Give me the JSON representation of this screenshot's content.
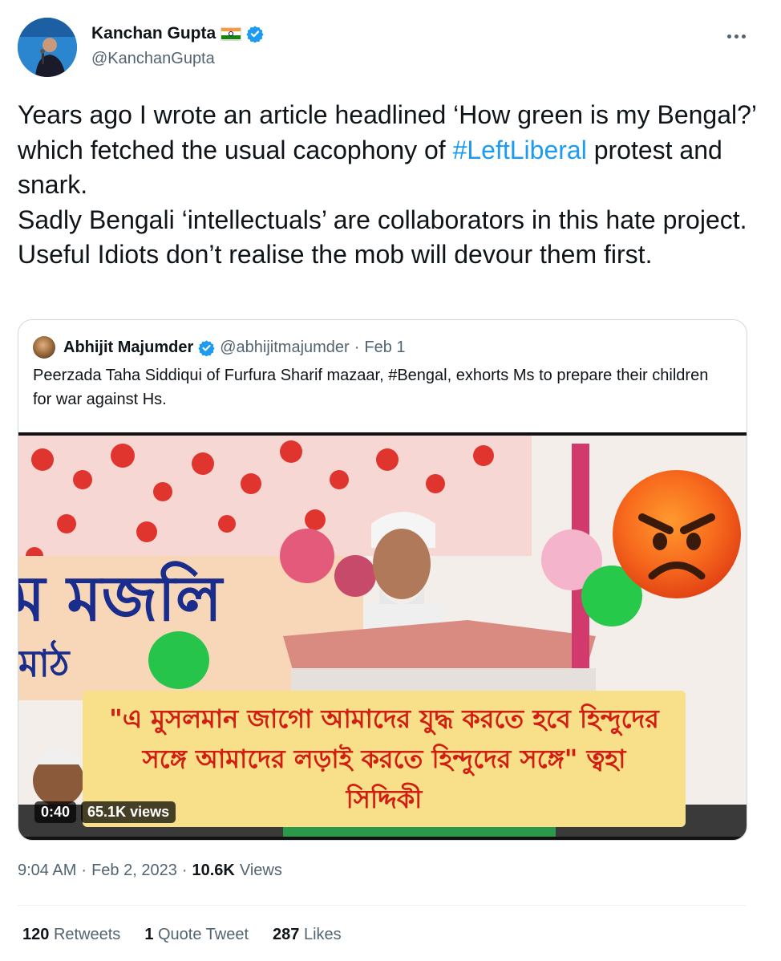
{
  "author": {
    "name": "Kanchan Gupta",
    "handle": "@KanchanGupta",
    "flag_icon": "india-flag-icon",
    "verified_color": "#1d9bf0"
  },
  "tweet": {
    "line1": "Years ago I wrote an article headlined ‘How green is my Bengal?’ which fetched the usual cacophony of ",
    "hashtag": "#LeftLiberal",
    "line1_end": " protest and snark.",
    "line2": "Sadly Bengali ‘intellectuals’ are collaborators in this hate project. Useful Idiots don’t realise the mob will devour them first."
  },
  "quote": {
    "name": "Abhijit Majumder",
    "handle": "@abhijitmajumder",
    "separator": "·",
    "date": "Feb 1",
    "text": "Peerzada Taha Siddiqui of Furfura Sharif mazaar, #Bengal, exhorts Ms to prepare their children for war against Hs.",
    "media": {
      "caption": "\"এ মুসলমান জাগো আমাদের যুদ্ধ করতে হবে হিন্দুদের সঙ্গে আমাদের লড়াই করতে হিন্দুদের সঙ্গে\" ত্বহা সিদ্দিকী",
      "banner_text": "ম মজলি",
      "banner_sub": "মাঠ",
      "duration": "0:40",
      "views": "65.1K views"
    }
  },
  "meta": {
    "time": "9:04 AM",
    "dot1": "·",
    "date": "Feb 2, 2023",
    "dot2": "·",
    "views_count": "10.6K",
    "views_label": "Views"
  },
  "stats": {
    "retweets_count": "120",
    "retweets_label": "Retweets",
    "quotes_count": "1",
    "quotes_label": "Quote Tweet",
    "likes_count": "287",
    "likes_label": "Likes"
  },
  "colors": {
    "link": "#1d9bf0",
    "secondary_text": "#536471",
    "caption_bg": "#f8e08a",
    "caption_text": "#d11d12"
  }
}
